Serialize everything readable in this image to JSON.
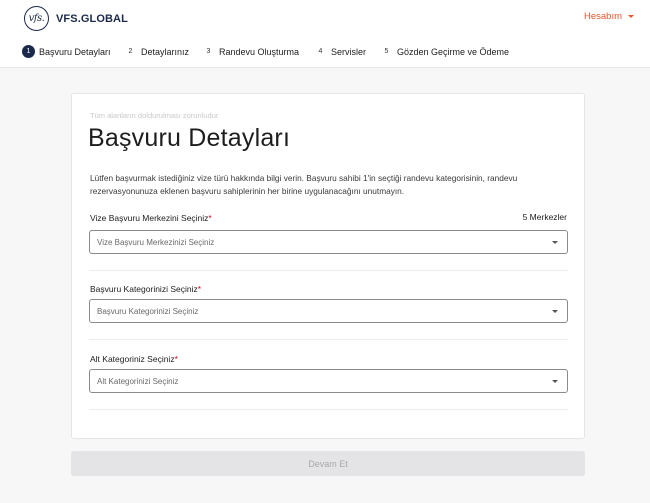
{
  "header": {
    "logo_mark": "vfs.",
    "logo_text": "VFS.GLOBAL",
    "account_label": "Hesabım"
  },
  "steps": [
    {
      "num": "1",
      "label": "Başvuru Detayları",
      "active": true
    },
    {
      "num": "2",
      "label": "Detaylarınız",
      "active": false
    },
    {
      "num": "3",
      "label": "Randevu Oluşturma",
      "active": false
    },
    {
      "num": "4",
      "label": "Servisler",
      "active": false
    },
    {
      "num": "5",
      "label": "Gözden Geçirme ve Ödeme",
      "active": false
    }
  ],
  "form": {
    "required_note": "Tüm alanların doldurulması zorunludur",
    "title": "Başvuru Detayları",
    "description": "Lütfen başvurmak istediğiniz vize türü hakkında bilgi verin. Başvuru sahibi 1'in seçtiği randevu kategorisinin, randevu rezervasyonunuza eklenen başvuru sahiplerinin her birine uygulanacağını unutmayın.",
    "centers_count": "5 Merkezler",
    "fields": [
      {
        "label": "Vize Başvuru Merkezini Seçiniz",
        "required_mark": "*",
        "placeholder": "Vize Başvuru Merkezinizi Seçiniz"
      },
      {
        "label": "Başvuru Kategorinizi Seçiniz",
        "required_mark": "*",
        "placeholder": "Başvuru Kategorinizi Seçiniz"
      },
      {
        "label": "Alt Kategoriniz Seçiniz",
        "required_mark": "*",
        "placeholder": "Alt Kategorinizi Seçiniz"
      }
    ]
  },
  "submit_label": "Devam Et",
  "colors": {
    "accent": "#e8562a",
    "brand": "#1b2a4a",
    "required": "#d0011b"
  }
}
